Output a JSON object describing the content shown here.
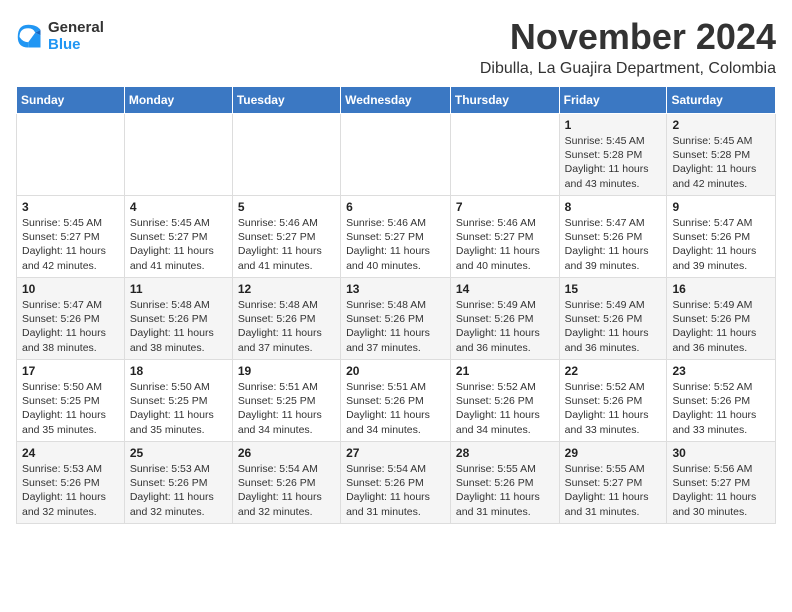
{
  "header": {
    "logo_general": "General",
    "logo_blue": "Blue",
    "month_title": "November 2024",
    "location": "Dibulla, La Guajira Department, Colombia"
  },
  "weekdays": [
    "Sunday",
    "Monday",
    "Tuesday",
    "Wednesday",
    "Thursday",
    "Friday",
    "Saturday"
  ],
  "weeks": [
    [
      {
        "day": "",
        "info": ""
      },
      {
        "day": "",
        "info": ""
      },
      {
        "day": "",
        "info": ""
      },
      {
        "day": "",
        "info": ""
      },
      {
        "day": "",
        "info": ""
      },
      {
        "day": "1",
        "info": "Sunrise: 5:45 AM\nSunset: 5:28 PM\nDaylight: 11 hours\nand 43 minutes."
      },
      {
        "day": "2",
        "info": "Sunrise: 5:45 AM\nSunset: 5:28 PM\nDaylight: 11 hours\nand 42 minutes."
      }
    ],
    [
      {
        "day": "3",
        "info": "Sunrise: 5:45 AM\nSunset: 5:27 PM\nDaylight: 11 hours\nand 42 minutes."
      },
      {
        "day": "4",
        "info": "Sunrise: 5:45 AM\nSunset: 5:27 PM\nDaylight: 11 hours\nand 41 minutes."
      },
      {
        "day": "5",
        "info": "Sunrise: 5:46 AM\nSunset: 5:27 PM\nDaylight: 11 hours\nand 41 minutes."
      },
      {
        "day": "6",
        "info": "Sunrise: 5:46 AM\nSunset: 5:27 PM\nDaylight: 11 hours\nand 40 minutes."
      },
      {
        "day": "7",
        "info": "Sunrise: 5:46 AM\nSunset: 5:27 PM\nDaylight: 11 hours\nand 40 minutes."
      },
      {
        "day": "8",
        "info": "Sunrise: 5:47 AM\nSunset: 5:26 PM\nDaylight: 11 hours\nand 39 minutes."
      },
      {
        "day": "9",
        "info": "Sunrise: 5:47 AM\nSunset: 5:26 PM\nDaylight: 11 hours\nand 39 minutes."
      }
    ],
    [
      {
        "day": "10",
        "info": "Sunrise: 5:47 AM\nSunset: 5:26 PM\nDaylight: 11 hours\nand 38 minutes."
      },
      {
        "day": "11",
        "info": "Sunrise: 5:48 AM\nSunset: 5:26 PM\nDaylight: 11 hours\nand 38 minutes."
      },
      {
        "day": "12",
        "info": "Sunrise: 5:48 AM\nSunset: 5:26 PM\nDaylight: 11 hours\nand 37 minutes."
      },
      {
        "day": "13",
        "info": "Sunrise: 5:48 AM\nSunset: 5:26 PM\nDaylight: 11 hours\nand 37 minutes."
      },
      {
        "day": "14",
        "info": "Sunrise: 5:49 AM\nSunset: 5:26 PM\nDaylight: 11 hours\nand 36 minutes."
      },
      {
        "day": "15",
        "info": "Sunrise: 5:49 AM\nSunset: 5:26 PM\nDaylight: 11 hours\nand 36 minutes."
      },
      {
        "day": "16",
        "info": "Sunrise: 5:49 AM\nSunset: 5:26 PM\nDaylight: 11 hours\nand 36 minutes."
      }
    ],
    [
      {
        "day": "17",
        "info": "Sunrise: 5:50 AM\nSunset: 5:25 PM\nDaylight: 11 hours\nand 35 minutes."
      },
      {
        "day": "18",
        "info": "Sunrise: 5:50 AM\nSunset: 5:25 PM\nDaylight: 11 hours\nand 35 minutes."
      },
      {
        "day": "19",
        "info": "Sunrise: 5:51 AM\nSunset: 5:25 PM\nDaylight: 11 hours\nand 34 minutes."
      },
      {
        "day": "20",
        "info": "Sunrise: 5:51 AM\nSunset: 5:26 PM\nDaylight: 11 hours\nand 34 minutes."
      },
      {
        "day": "21",
        "info": "Sunrise: 5:52 AM\nSunset: 5:26 PM\nDaylight: 11 hours\nand 34 minutes."
      },
      {
        "day": "22",
        "info": "Sunrise: 5:52 AM\nSunset: 5:26 PM\nDaylight: 11 hours\nand 33 minutes."
      },
      {
        "day": "23",
        "info": "Sunrise: 5:52 AM\nSunset: 5:26 PM\nDaylight: 11 hours\nand 33 minutes."
      }
    ],
    [
      {
        "day": "24",
        "info": "Sunrise: 5:53 AM\nSunset: 5:26 PM\nDaylight: 11 hours\nand 32 minutes."
      },
      {
        "day": "25",
        "info": "Sunrise: 5:53 AM\nSunset: 5:26 PM\nDaylight: 11 hours\nand 32 minutes."
      },
      {
        "day": "26",
        "info": "Sunrise: 5:54 AM\nSunset: 5:26 PM\nDaylight: 11 hours\nand 32 minutes."
      },
      {
        "day": "27",
        "info": "Sunrise: 5:54 AM\nSunset: 5:26 PM\nDaylight: 11 hours\nand 31 minutes."
      },
      {
        "day": "28",
        "info": "Sunrise: 5:55 AM\nSunset: 5:26 PM\nDaylight: 11 hours\nand 31 minutes."
      },
      {
        "day": "29",
        "info": "Sunrise: 5:55 AM\nSunset: 5:27 PM\nDaylight: 11 hours\nand 31 minutes."
      },
      {
        "day": "30",
        "info": "Sunrise: 5:56 AM\nSunset: 5:27 PM\nDaylight: 11 hours\nand 30 minutes."
      }
    ]
  ]
}
